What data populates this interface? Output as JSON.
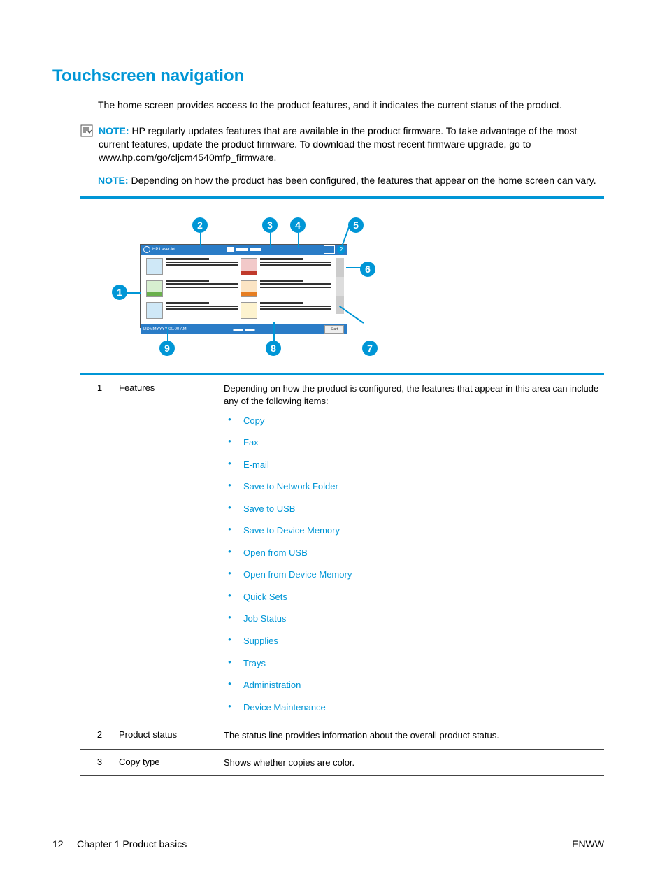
{
  "title": "Touchscreen navigation",
  "intro": "The home screen provides access to the product features, and it indicates the current status of the product.",
  "note1": {
    "label": "NOTE:",
    "text_a": "HP regularly updates features that are available in the product firmware. To take advantage of the most current features, update the product firmware. To download the most recent firmware upgrade, go to ",
    "link": "www.hp.com/go/cljcm4540mfp_firmware",
    "text_b": "."
  },
  "note2": {
    "label": "NOTE:",
    "text": "Depending on how the product has been configured, the features that appear on the home screen can vary."
  },
  "diagram": {
    "header_text": "HP LaserJet",
    "footer_date": "DDMMYYYY  00.00 AM",
    "footer_btn": "Start"
  },
  "callouts": [
    "1",
    "2",
    "3",
    "4",
    "5",
    "6",
    "7",
    "8",
    "9"
  ],
  "table": [
    {
      "num": "1",
      "label": "Features",
      "desc": "Depending on how the product is configured, the features that appear in this area can include any of the following items:",
      "items": [
        "Copy",
        "Fax",
        "E-mail",
        "Save to Network Folder",
        "Save to USB",
        "Save to Device Memory",
        "Open from USB",
        "Open from Device Memory",
        "Quick Sets",
        "Job Status",
        "Supplies",
        "Trays",
        "Administration",
        "Device Maintenance"
      ]
    },
    {
      "num": "2",
      "label": "Product status",
      "desc": "The status line provides information about the overall product status."
    },
    {
      "num": "3",
      "label": "Copy type",
      "desc": "Shows whether copies are color."
    }
  ],
  "footer": {
    "page": "12",
    "chapter": "Chapter 1   Product basics",
    "lang": "ENWW"
  }
}
